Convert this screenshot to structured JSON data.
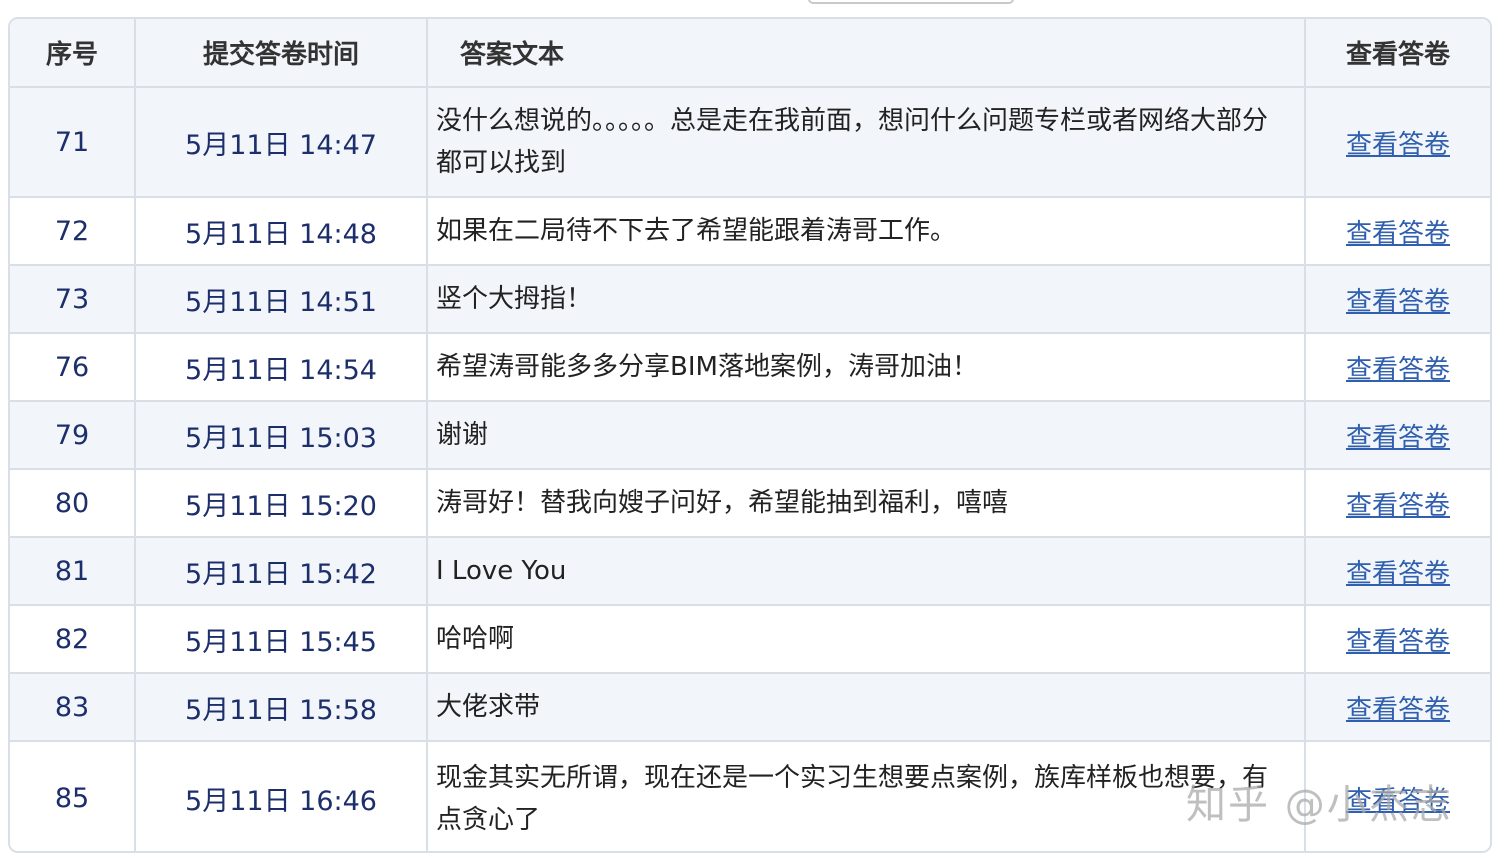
{
  "header": {
    "col_no": "序号",
    "col_time": "提交答卷时间",
    "col_text": "答案文本",
    "col_view": "查看答卷"
  },
  "rows": [
    {
      "no": "71",
      "time": "5月11日 14:47",
      "text": "没什么想说的。。。。。总是走在我前面，想问什么问题专栏或者网络大部分都可以找到",
      "view": "查看答卷"
    },
    {
      "no": "72",
      "time": "5月11日 14:48",
      "text": "如果在二局待不下去了希望能跟着涛哥工作。",
      "view": "查看答卷"
    },
    {
      "no": "73",
      "time": "5月11日 14:51",
      "text": "竖个大拇指！",
      "view": "查看答卷"
    },
    {
      "no": "76",
      "time": "5月11日 14:54",
      "text": "希望涛哥能多多分享BIM落地案例，涛哥加油！",
      "view": "查看答卷"
    },
    {
      "no": "79",
      "time": "5月11日 15:03",
      "text": "谢谢",
      "view": "查看答卷"
    },
    {
      "no": "80",
      "time": "5月11日 15:20",
      "text": "涛哥好！替我向嫂子问好，希望能抽到福利，嘻嘻",
      "view": "查看答卷"
    },
    {
      "no": "81",
      "time": "5月11日 15:42",
      "text": "I Love You",
      "view": "查看答卷"
    },
    {
      "no": "82",
      "time": "5月11日 15:45",
      "text": "哈哈啊",
      "view": "查看答卷"
    },
    {
      "no": "83",
      "time": "5月11日 15:58",
      "text": "大佬求带",
      "view": "查看答卷"
    },
    {
      "no": "85",
      "time": "5月11日 16:46",
      "text": "现金其实无所谓，现在还是一个实习生想要点案例，族库样板也想要，有点贪心了",
      "view": "查看答卷"
    }
  ],
  "watermark": "知乎 @小杰志",
  "colors": {
    "header_bg": "#f2f6fa",
    "row_alt_bg": "#f2f6fa",
    "border": "#d9dfe6",
    "id_text": "#1d2f6b",
    "link": "#2f5fae"
  }
}
